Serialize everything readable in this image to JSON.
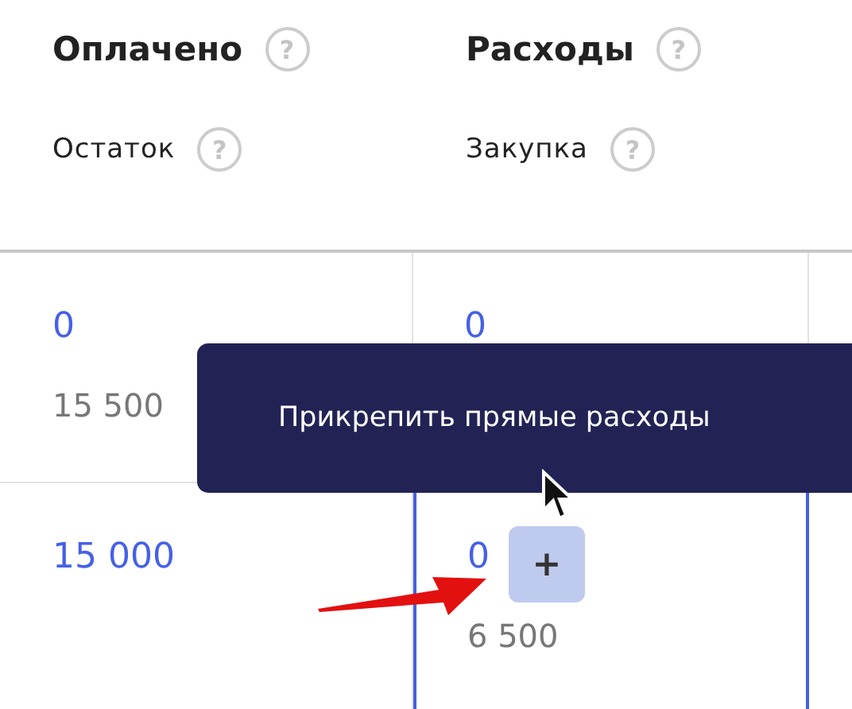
{
  "columns": [
    {
      "title": "Оплачено",
      "title_help": "?",
      "subtitle": "Остаток",
      "subtitle_help": "?"
    },
    {
      "title": "Расходы",
      "title_help": "?",
      "subtitle": "Закупка",
      "subtitle_help": "?"
    }
  ],
  "rows": [
    {
      "cells": [
        {
          "value": "0",
          "sub": "15 500",
          "highlighted": false
        },
        {
          "value": "0",
          "highlighted": false
        }
      ]
    },
    {
      "cells": [
        {
          "value": "15 000",
          "highlighted": false
        },
        {
          "value": "0",
          "add_button": "+",
          "sub": "6 500",
          "highlighted": true
        }
      ]
    }
  ],
  "tooltip": "Прикрепить прямые расходы"
}
